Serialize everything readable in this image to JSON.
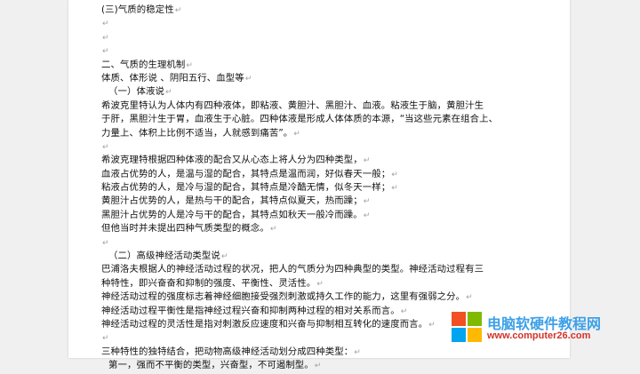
{
  "paragraph_mark": "↵",
  "lines": [
    {
      "text": "(三)气质的稳定性",
      "indent": false
    },
    {
      "text": "",
      "indent": false
    },
    {
      "text": "",
      "indent": false
    },
    {
      "text": "",
      "indent": false
    },
    {
      "text": "二、气质的生理机制",
      "indent": false
    },
    {
      "text": "体质、体形说 、阴阳五行、血型等",
      "indent": false
    },
    {
      "text": "（一）体液说",
      "indent": true
    },
    {
      "text": "希波克里特认为人体内有四种液体，即粘液、黄胆汁、黑胆汁、血液。粘液生于脑，黄胆汁生",
      "indent": false,
      "no_mark": true
    },
    {
      "text": "于肝，黑胆汁生于胃，血液生于心脏。四种体液是形成人体体质的本源，“当这些元素在组合上、",
      "indent": false,
      "no_mark": true
    },
    {
      "text": "力量上、体积上比例不适当，人就感到痛苦”。",
      "indent": false
    },
    {
      "text": "",
      "indent": false
    },
    {
      "text": "希波克理特根据四种体液的配合又从心态上将人分为四种类型，",
      "indent": false
    },
    {
      "text": "血液占优势的人，是温与湿的配合，其特点是温而润，好似春天一般；",
      "indent": false
    },
    {
      "text": "粘液占优势的人，是冷与湿的配合，其特点是冷酷无情，似冬天一样；",
      "indent": false
    },
    {
      "text": "黄胆汁占优势的人，是热与干的配合，其特点似夏天，热而躁；",
      "indent": false
    },
    {
      "text": "黑胆汁占优势的人是冷与干的配合，其特点如秋天一般冷而躁。",
      "indent": false
    },
    {
      "text": "但他当时并未提出四种气质类型的概念。",
      "indent": false
    },
    {
      "text": "",
      "indent": false
    },
    {
      "text": "（二）高级神经活动类型说",
      "indent": true
    },
    {
      "text": "巴浦洛夫根据人的神经活动过程的状况，把人的气质分为四种典型的类型。神经活动过程有三",
      "indent": false,
      "no_mark": true
    },
    {
      "text": "种特性，即兴奋奋和抑制的强度、平衡性、灵活性。",
      "indent": false
    },
    {
      "text": "神经活动过程的强度标志着神经细胞接受强烈刺激或持久工作的能力，这里有强弱之分。",
      "indent": false
    },
    {
      "text": "神经活动过程平衡性是指神经过程兴奋和抑制两种过程的相对关系而言。",
      "indent": false
    },
    {
      "text": "神经活动过程的灵活性是指对刺激反应速度和兴奋与抑制相互转化的速度而言。",
      "indent": false
    },
    {
      "text": "",
      "indent": false
    },
    {
      "text": "三种特性的独特结合，把动物高级神经活动划分成四种类型：",
      "indent": false
    },
    {
      "text": "第一，强而不平衡的类型，兴奋型，不可遏制型。",
      "indent": true
    }
  ],
  "watermark": {
    "title": "电脑软硬件教程网",
    "url": "www.computer26.com",
    "colors": {
      "red": "#f25022",
      "green": "#7fba00",
      "blue": "#00a4ef",
      "yellow": "#ffb900"
    }
  }
}
